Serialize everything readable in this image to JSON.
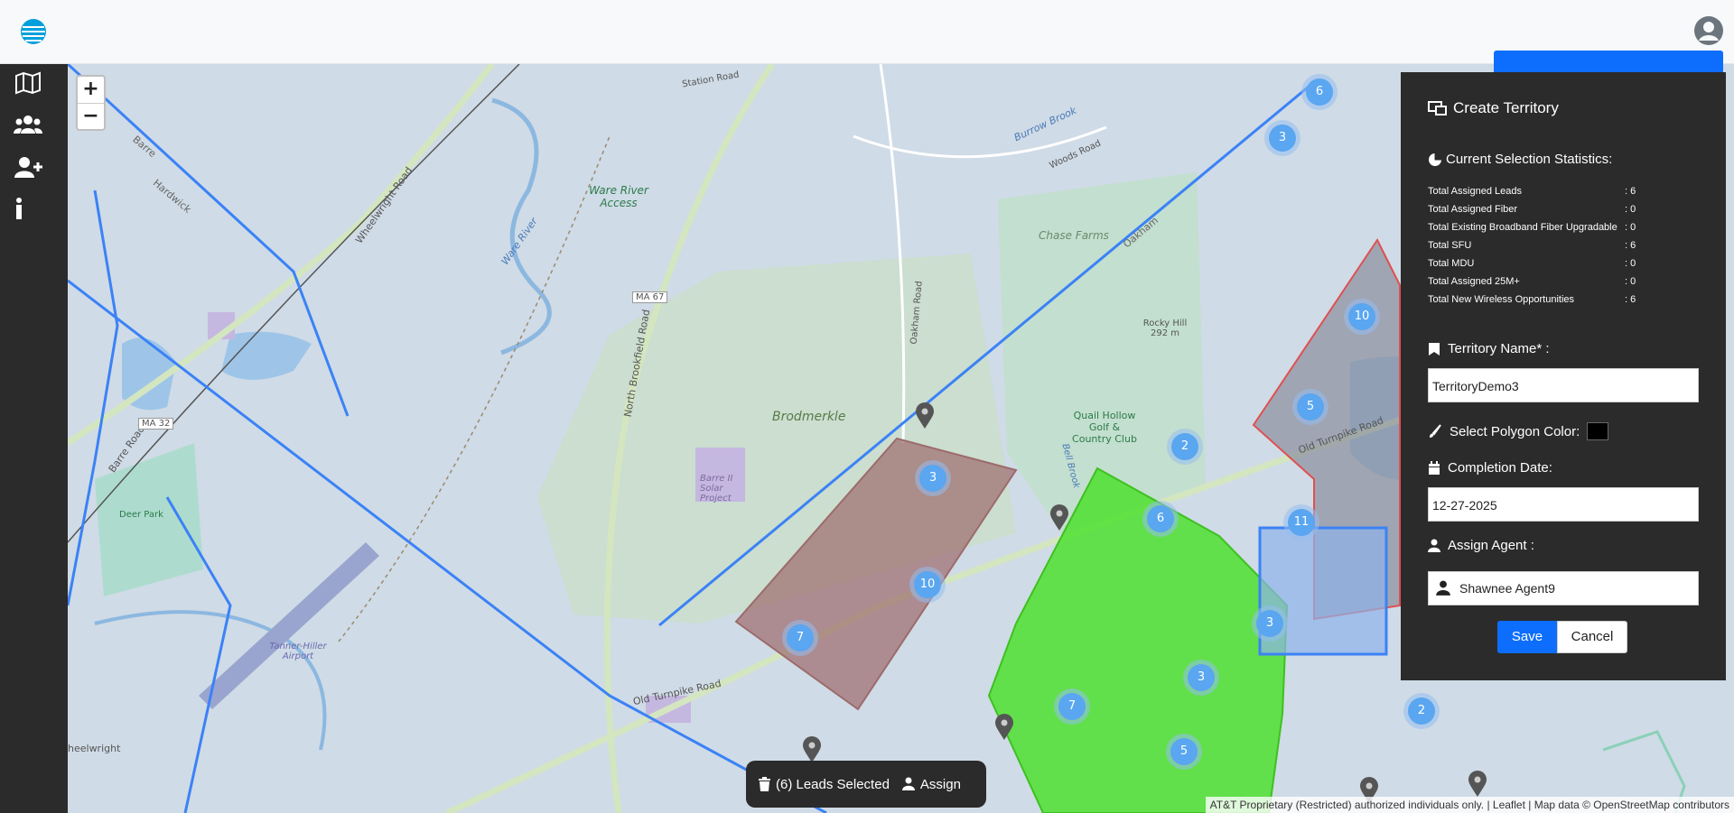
{
  "topbar": {
    "logo_icon": "att-globe-icon",
    "avatar_icon": "user-circle-icon"
  },
  "sidebar": {
    "items": [
      {
        "icon": "map-icon"
      },
      {
        "icon": "users-icon"
      },
      {
        "icon": "user-plus-icon"
      },
      {
        "icon": "info-icon"
      }
    ]
  },
  "map": {
    "zoom_in": "+",
    "zoom_out": "−",
    "labels": {
      "ware_river_access": "Ware River Access",
      "chase_farms": "Chase Farms",
      "brodmerkle": "Brodmerkle",
      "barre_solar": "Barre II Solar Project",
      "rocky_hill": "Rocky Hill 292 m",
      "quail_hollow": "Quail Hollow Golf & Country Club",
      "deer_park": "Deer Park",
      "tanner_hiller": "Tanner-Hiller Airport",
      "old_turnpike_1": "Old Turnpike Road",
      "old_turnpike_2": "Old Turnpike Road",
      "north_brookfield": "North Brookfield Road",
      "wheelwright_rd": "Wheelwright Road",
      "barre_road": "Barre Road",
      "ma32": "MA 32",
      "ma67": "MA 67",
      "oakham_road": "Oakham Road",
      "station_road": "Station Road",
      "woods_road": "Woods Road",
      "burrow_brook": "Burrow Brook",
      "ware_river": "Ware River",
      "barre": "Barre",
      "hardwick": "Hardwick",
      "wheelwright": "heelwright",
      "oakham": "Oakham",
      "bell_brook": "Bell Brook"
    },
    "clusters": [
      "6",
      "3",
      "10",
      "5",
      "11",
      "3",
      "2",
      "2",
      "6",
      "3",
      "10",
      "7",
      "7",
      "3",
      "5"
    ],
    "attribution": "AT&T Proprietary (Restricted) authorized individuals only. | Leaflet | Map data © OpenStreetMap contributors"
  },
  "panel": {
    "title": "Create Territory",
    "title_icon": "territory-icon",
    "stats_heading": "Current Selection Statistics:",
    "stats_icon": "pie-chart-icon",
    "stats": [
      {
        "label": "Total Assigned Leads",
        "value": ": 6"
      },
      {
        "label": "Total Assigned Fiber",
        "value": ": 0"
      },
      {
        "label": "Total Existing Broadband Fiber Upgradable",
        "value": ": 0"
      },
      {
        "label": "Total SFU",
        "value": ": 6"
      },
      {
        "label": "Total MDU",
        "value": ": 0"
      },
      {
        "label": "Total Assigned 25M+",
        "value": ": 0"
      },
      {
        "label": "Total New Wireless Opportunities",
        "value": ": 6"
      }
    ],
    "territory_name_label": "Territory Name* :",
    "territory_name_value": "TerritoryDemo3",
    "polygon_color_label": "Select Polygon Color:",
    "polygon_color": "#000000",
    "completion_label": "Completion Date:",
    "completion_value": "12-27-2025",
    "assign_agent_label": "Assign Agent :",
    "agent_value": "Shawnee Agent9",
    "save_label": "Save",
    "cancel_label": "Cancel"
  },
  "bottom_bar": {
    "leads_selected": "(6) Leads Selected",
    "assign": "Assign"
  },
  "colors": {
    "accent": "#0d6efd",
    "panel_bg": "#2b2b2b",
    "cluster": "#5aa6f0",
    "green_polygon": "#4ee02f",
    "brown_polygon": "#9c6b6b",
    "blue_line": "#3b82f6"
  }
}
